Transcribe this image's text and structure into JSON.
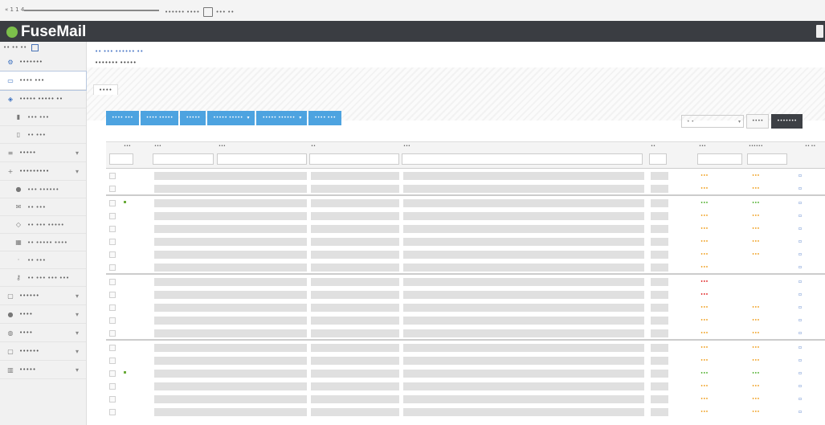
{
  "brand": {
    "name": "FuseMail"
  },
  "topbar": {
    "crumb": "« 1 1 4",
    "links": [
      "•••••• ••••",
      "••• ••"
    ]
  },
  "sidebar": {
    "top_label": "•• •• ••",
    "items": [
      {
        "label": "•••••••",
        "icon": "gear-icon",
        "chev": false,
        "sub": false,
        "active": false
      },
      {
        "label": "•••• •••",
        "icon": "inbox-icon",
        "chev": false,
        "sub": false,
        "active": true
      },
      {
        "label": "••••• ••••• ••",
        "icon": "shield-icon",
        "chev": false,
        "sub": false,
        "active": false
      },
      {
        "label": "••• •••",
        "icon": "chart-icon",
        "chev": false,
        "sub": true,
        "active": false
      },
      {
        "label": "•• •••",
        "icon": "doc-icon",
        "chev": false,
        "sub": true,
        "active": false
      },
      {
        "label": "•••••",
        "icon": "list-icon",
        "chev": true,
        "sub": false,
        "active": false
      },
      {
        "label": "•••••••••",
        "icon": "plus-icon",
        "chev": true,
        "sub": false,
        "active": false
      },
      {
        "label": "••• ••••••",
        "icon": "user-icon",
        "chev": false,
        "sub": true,
        "active": false
      },
      {
        "label": "•• •••",
        "icon": "mail-icon",
        "chev": false,
        "sub": true,
        "active": false
      },
      {
        "label": "•• ••• •••••",
        "icon": "filter-icon",
        "chev": false,
        "sub": true,
        "active": false
      },
      {
        "label": "•• ••••• ••••",
        "icon": "table-icon",
        "chev": false,
        "sub": true,
        "active": false
      },
      {
        "label": "•• •••",
        "icon": "dot-icon",
        "chev": false,
        "sub": true,
        "active": false
      },
      {
        "label": "•• ••• ••• •••",
        "icon": "key-icon",
        "chev": false,
        "sub": true,
        "active": false
      },
      {
        "label": "••••••",
        "icon": "folder-icon",
        "chev": true,
        "sub": false,
        "active": false
      },
      {
        "label": "••••",
        "icon": "person-icon",
        "chev": true,
        "sub": false,
        "active": false
      },
      {
        "label": "••••",
        "icon": "users-icon",
        "chev": true,
        "sub": false,
        "active": false
      },
      {
        "label": "••••••",
        "icon": "folder-icon",
        "chev": true,
        "sub": false,
        "active": false
      },
      {
        "label": "•••••",
        "icon": "bars-icon",
        "chev": true,
        "sub": false,
        "active": false
      }
    ]
  },
  "main": {
    "crumb": "•• ••• •••••• ••",
    "title": "••••••• •••••",
    "tab": "••••",
    "toolbar": [
      {
        "label": "•••• •••",
        "dd": false
      },
      {
        "label": "•••• •••••",
        "dd": false
      },
      {
        "label": "•••••",
        "dd": false
      },
      {
        "label": "••••• •••••",
        "dd": true
      },
      {
        "label": "••••• ••••••",
        "dd": true
      },
      {
        "label": "•••• •••",
        "dd": false
      }
    ],
    "perpage": "• •",
    "btn_a": "••••",
    "btn_b": "•••••••"
  },
  "table": {
    "columns": [
      "•••",
      "•••",
      "•••",
      "••",
      "•••",
      "••",
      "•••",
      "••••••",
      "•• ••"
    ],
    "rows": [
      {
        "dot": false,
        "s1": "•••",
        "s1c": "orange",
        "s2": "•••",
        "s2c": "orange",
        "end": false
      },
      {
        "dot": false,
        "s1": "•••",
        "s1c": "orange",
        "s2": "•••",
        "s2c": "orange",
        "end": true
      },
      {
        "dot": true,
        "s1": "•••",
        "s1c": "green",
        "s2": "•••",
        "s2c": "green",
        "end": false
      },
      {
        "dot": false,
        "s1": "•••",
        "s1c": "orange",
        "s2": "•••",
        "s2c": "orange",
        "end": false
      },
      {
        "dot": false,
        "s1": "•••",
        "s1c": "orange",
        "s2": "•••",
        "s2c": "orange",
        "end": false
      },
      {
        "dot": false,
        "s1": "•••",
        "s1c": "orange",
        "s2": "•••",
        "s2c": "orange",
        "end": false
      },
      {
        "dot": false,
        "s1": "•••",
        "s1c": "orange",
        "s2": "•••",
        "s2c": "orange",
        "end": false
      },
      {
        "dot": false,
        "s1": "•••",
        "s1c": "orange",
        "s2": "",
        "s2c": "orange",
        "end": true
      },
      {
        "dot": false,
        "s1": "•••",
        "s1c": "red",
        "s2": "",
        "s2c": "red",
        "end": false
      },
      {
        "dot": false,
        "s1": "•••",
        "s1c": "red",
        "s2": "",
        "s2c": "red",
        "end": false
      },
      {
        "dot": false,
        "s1": "•••",
        "s1c": "orange",
        "s2": "•••",
        "s2c": "orange",
        "end": false
      },
      {
        "dot": false,
        "s1": "•••",
        "s1c": "orange",
        "s2": "•••",
        "s2c": "orange",
        "end": false
      },
      {
        "dot": false,
        "s1": "•••",
        "s1c": "orange",
        "s2": "•••",
        "s2c": "orange",
        "end": true
      },
      {
        "dot": false,
        "s1": "•••",
        "s1c": "orange",
        "s2": "•••",
        "s2c": "orange",
        "end": false
      },
      {
        "dot": false,
        "s1": "•••",
        "s1c": "orange",
        "s2": "•••",
        "s2c": "orange",
        "end": false
      },
      {
        "dot": true,
        "s1": "•••",
        "s1c": "green",
        "s2": "•••",
        "s2c": "green",
        "end": false
      },
      {
        "dot": false,
        "s1": "•••",
        "s1c": "orange",
        "s2": "•••",
        "s2c": "orange",
        "end": false
      },
      {
        "dot": false,
        "s1": "•••",
        "s1c": "orange",
        "s2": "•••",
        "s2c": "orange",
        "end": false
      },
      {
        "dot": false,
        "s1": "•••",
        "s1c": "orange",
        "s2": "•••",
        "s2c": "orange",
        "end": false
      }
    ]
  },
  "colors": {
    "header": "#3a3d42",
    "accent": "#4da3e0",
    "orange": "#f0a020",
    "green": "#4caf2a",
    "red": "#e02020",
    "brand_leaf": "#7cc04b"
  }
}
